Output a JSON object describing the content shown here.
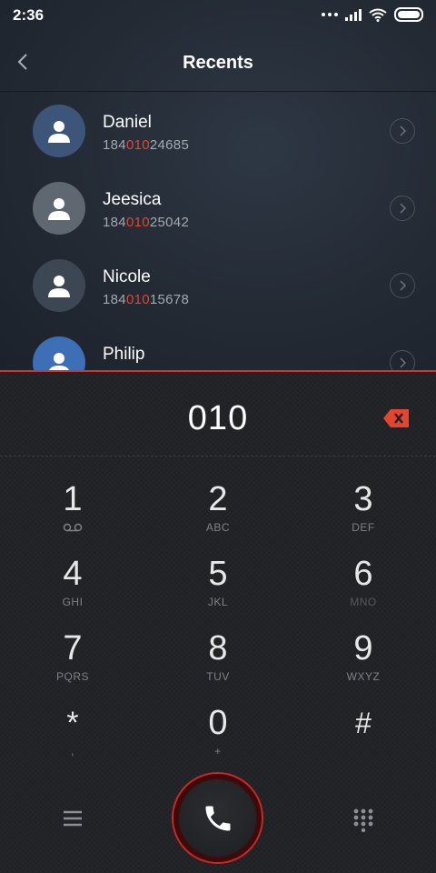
{
  "status_bar": {
    "time": "2:36"
  },
  "header": {
    "title": "Recents"
  },
  "recents": [
    {
      "name": "Daniel",
      "number_prefix": "184",
      "number_match": "010",
      "number_suffix": "24685",
      "avatar_color": "#3d5578"
    },
    {
      "name": "Jeesica",
      "number_prefix": "184",
      "number_match": "010",
      "number_suffix": "25042",
      "avatar_color": "#5f6771"
    },
    {
      "name": "Nicole",
      "number_prefix": "184",
      "number_match": "010",
      "number_suffix": "15678",
      "avatar_color": "#3d4653"
    },
    {
      "name": "Philip",
      "number_prefix": "",
      "number_match": "",
      "number_suffix": "",
      "avatar_color": "#3c6fb6"
    }
  ],
  "dialer": {
    "input": "010",
    "keys": [
      {
        "main": "1",
        "sub": ""
      },
      {
        "main": "2",
        "sub": "ABC"
      },
      {
        "main": "3",
        "sub": "DEF"
      },
      {
        "main": "4",
        "sub": "GHI"
      },
      {
        "main": "5",
        "sub": "JKL"
      },
      {
        "main": "6",
        "sub": "MNO"
      },
      {
        "main": "7",
        "sub": "PQRS"
      },
      {
        "main": "8",
        "sub": "TUV"
      },
      {
        "main": "9",
        "sub": "WXYZ"
      },
      {
        "main": "*",
        "sub": ","
      },
      {
        "main": "0",
        "sub": "+"
      },
      {
        "main": "#",
        "sub": ""
      }
    ]
  },
  "colors": {
    "accent": "#e4452f",
    "call_ring": "#c72929"
  }
}
